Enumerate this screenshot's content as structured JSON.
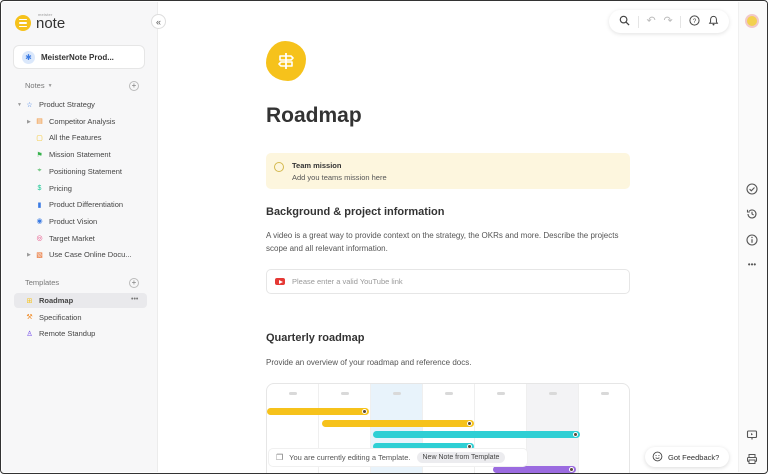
{
  "app": {
    "logo_text": "note",
    "logo_sup": "meister"
  },
  "sidebar": {
    "workspace_name": "MeisterNote Prod...",
    "notes_header": "Notes",
    "templates_header": "Templates",
    "tree": [
      {
        "label": "Product Strategy",
        "icon": "star-icon",
        "color": "#3b7be3"
      },
      {
        "label": "Competitor Analysis",
        "icon": "note-icon",
        "color": "#f08a24"
      },
      {
        "label": "All the Features",
        "icon": "square-icon",
        "color": "#f6c21b"
      },
      {
        "label": "Mission Statement",
        "icon": "flag-icon",
        "color": "#37b24d"
      },
      {
        "label": "Positioning Statement",
        "icon": "pin-icon",
        "color": "#37b24d"
      },
      {
        "label": "Pricing",
        "icon": "dollar-icon",
        "color": "#20c997"
      },
      {
        "label": "Product Differentiation",
        "icon": "bars-icon",
        "color": "#3b7be3"
      },
      {
        "label": "Product Vision",
        "icon": "eye-icon",
        "color": "#3b7be3"
      },
      {
        "label": "Target Market",
        "icon": "target-icon",
        "color": "#e64980"
      },
      {
        "label": "Use Case Online Docu...",
        "icon": "doc-icon",
        "color": "#e8590c"
      }
    ],
    "templates": [
      {
        "label": "Roadmap",
        "icon": "signpost-icon",
        "color": "#f6c21b"
      },
      {
        "label": "Specification",
        "icon": "hammer-icon",
        "color": "#f08a24"
      },
      {
        "label": "Remote Standup",
        "icon": "person-icon",
        "color": "#7048e8"
      }
    ]
  },
  "main": {
    "title": "Roadmap",
    "callout": {
      "title": "Team mission",
      "text": "Add you teams mission here"
    },
    "section1": {
      "heading": "Background & project information",
      "text": "A video is a great way to provide context on the strategy, the OKRs and more. Describe the projects scope and all relevant information.",
      "youtube_placeholder": "Please enter a valid YouTube link"
    },
    "section2": {
      "heading": "Quarterly roadmap",
      "text": "Provide an overview of your roadmap and reference docs."
    },
    "gantt_bars": [
      {
        "color": "#f6c21b",
        "start": 0.0,
        "end": 0.28,
        "row": 0
      },
      {
        "color": "#f6c21b",
        "start": 0.15,
        "end": 0.57,
        "row": 1
      },
      {
        "color": "#2fcfd4",
        "start": 0.29,
        "end": 0.86,
        "row": 2
      },
      {
        "color": "#2fcfd4",
        "start": 0.29,
        "end": 0.57,
        "row": 3
      },
      {
        "color": "#2fcfd4",
        "start": 0.42,
        "end": 0.71,
        "row": 4
      },
      {
        "color": "#9b6be0",
        "start": 0.62,
        "end": 0.85,
        "row": 5
      }
    ]
  },
  "toast": {
    "text": "You are currently editing a Template.",
    "button": "New Note from Template"
  },
  "feedback": {
    "label": "Got Feedback?"
  }
}
